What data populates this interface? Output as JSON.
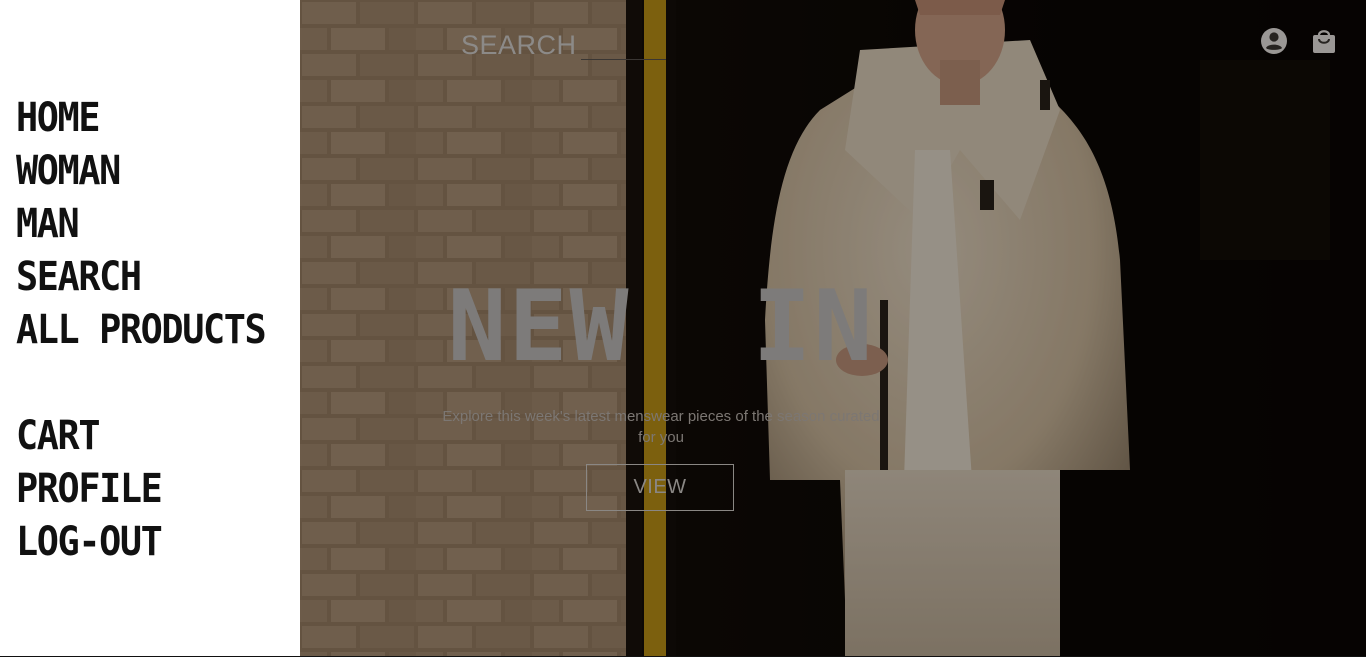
{
  "side_menu": {
    "primary": [
      {
        "label": "HOME"
      },
      {
        "label": "WOMAN"
      },
      {
        "label": "MAN"
      },
      {
        "label": "SEARCH"
      },
      {
        "label": "ALL PRODUCTS"
      }
    ],
    "secondary": [
      {
        "label": "CART"
      },
      {
        "label": "PROFILE"
      },
      {
        "label": "LOG-OUT"
      }
    ]
  },
  "header": {
    "search_label": "SEARCH",
    "profile_icon": "account-circle-icon",
    "bag_icon": "shopping-bag-icon"
  },
  "hero": {
    "title": "NEW  IN",
    "subtitle": "Explore this week's latest menswear pieces of the season curated for you",
    "cta_label": "VIEW"
  },
  "colors": {
    "menu_background": "#ffffff",
    "menu_text": "#111111",
    "hero_text": "#7d7b7a",
    "icon": "#9a9795"
  }
}
